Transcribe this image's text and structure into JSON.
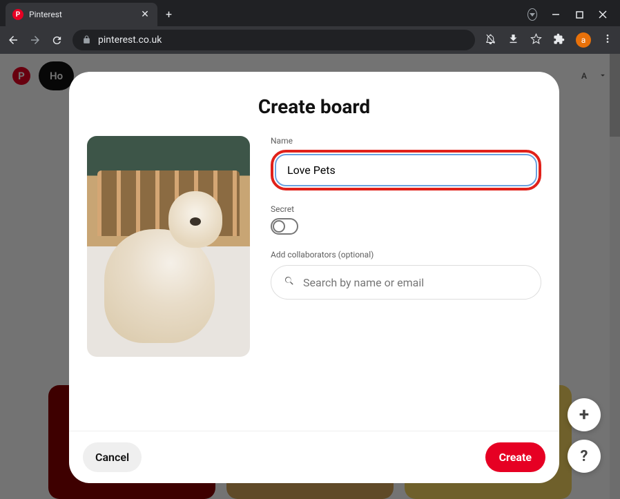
{
  "browser": {
    "tab_title": "Pinterest",
    "url": "pinterest.co.uk",
    "avatar_letter": "a"
  },
  "page": {
    "logo_letter": "P",
    "home_label": "Ho",
    "avatar_letter": "A"
  },
  "modal": {
    "title": "Create board",
    "name_label": "Name",
    "name_value": "Love Pets",
    "secret_label": "Secret",
    "collab_label": "Add collaborators (optional)",
    "collab_placeholder": "Search by name or email",
    "cancel_label": "Cancel",
    "create_label": "Create"
  },
  "fab": {
    "plus": "+",
    "help": "?"
  }
}
